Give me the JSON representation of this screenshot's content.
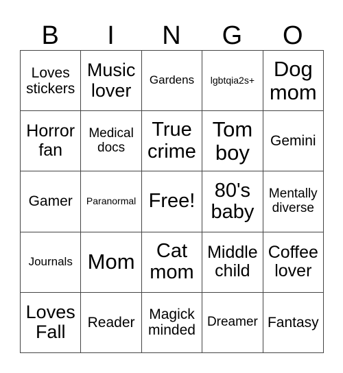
{
  "title_letters": [
    "B",
    "I",
    "N",
    "G",
    "O"
  ],
  "cells": [
    [
      "Loves stickers",
      "Music lover",
      "Gardens",
      "lgbtqia2s+",
      "Dog mom"
    ],
    [
      "Horror fan",
      "Medical docs",
      "True crime",
      "Tom boy",
      "Gemini"
    ],
    [
      "Gamer",
      "Paranormal",
      "Free!",
      "80's baby",
      "Mentally diverse"
    ],
    [
      "Journals",
      "Mom",
      "Cat mom",
      "Middle child",
      "Coffee lover"
    ],
    [
      "Loves Fall",
      "Reader",
      "Magick minded",
      "Dreamer",
      "Fantasy"
    ]
  ]
}
